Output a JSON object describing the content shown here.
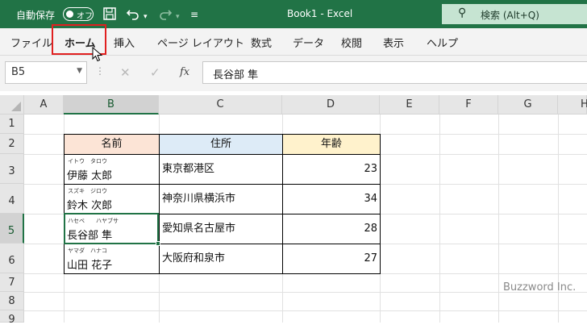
{
  "titlebar": {
    "autosave_label": "自動保存",
    "autosave_state": "オフ",
    "save_icon": "save-icon",
    "undo_icon": "undo-icon",
    "redo_icon": "redo-icon",
    "customize_icon": "customize-icon",
    "doc_title": "Book1 - Excel",
    "search_placeholder": "検索 (Alt+Q)",
    "accent": "#217346"
  },
  "ribbon": {
    "tabs": [
      "ファイル",
      "ホーム",
      "挿入",
      "ページ レイアウト",
      "数式",
      "データ",
      "校閲",
      "表示",
      "ヘルプ"
    ],
    "active_tab": "ホーム",
    "highlight_color": "#e02020"
  },
  "formula_bar": {
    "name_box": "B5",
    "cancel_symbol": "✕",
    "enter_symbol": "✓",
    "fx_label": "fx",
    "value": "長谷部 隼"
  },
  "sheet": {
    "columns": [
      "A",
      "B",
      "C",
      "D",
      "E",
      "F",
      "G",
      "H"
    ],
    "rows": [
      "1",
      "2",
      "3",
      "4",
      "5",
      "6",
      "7",
      "8",
      "9"
    ],
    "selected_cell": "B5",
    "table": {
      "headers": [
        {
          "text": "名前",
          "color": "#fce4d6"
        },
        {
          "text": "住所",
          "color": "#ddebf7"
        },
        {
          "text": "年齢",
          "color": "#fff2cc"
        }
      ],
      "rows": [
        {
          "furigana": "イトウ　タロウ",
          "name": "伊藤 太郎",
          "address": "東京都港区",
          "age": "23"
        },
        {
          "furigana": "スズキ　ジロウ",
          "name": "鈴木 次郎",
          "address": "神奈川県横浜市",
          "age": "34"
        },
        {
          "furigana": "ハセベ　　ハヤブサ",
          "name": "長谷部 隼",
          "address": "愛知県名古屋市",
          "age": "28"
        },
        {
          "furigana": "ヤマダ　ハナコ",
          "name": "山田 花子",
          "address": "大阪府和泉市",
          "age": "27"
        }
      ]
    }
  },
  "watermark": "Buzzword Inc."
}
